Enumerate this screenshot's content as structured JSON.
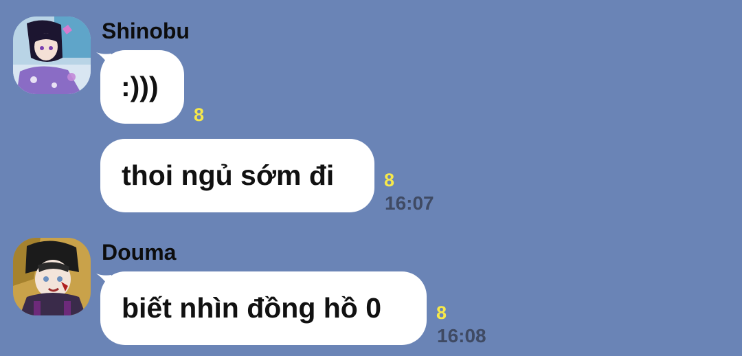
{
  "messages": [
    {
      "sender": "Shinobu",
      "bubbles": [
        {
          "text": ":)))",
          "read_count": "8",
          "time": ""
        },
        {
          "text": "thoi ngủ sớm đi",
          "read_count": "8",
          "time": "16:07"
        }
      ]
    },
    {
      "sender": "Douma",
      "bubbles": [
        {
          "text": "biết nhìn đồng hồ 0",
          "read_count": "8",
          "time": "16:08"
        }
      ]
    }
  ],
  "colors": {
    "background": "#6a84b6",
    "bubble": "#ffffff",
    "read_count": "#f7e94a",
    "timestamp": "#3f4a63"
  }
}
